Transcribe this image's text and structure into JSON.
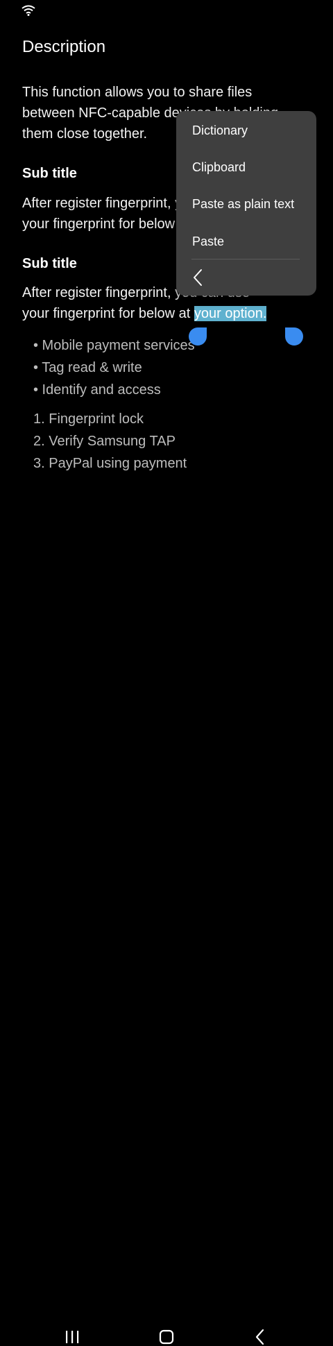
{
  "content": {
    "title": "Description",
    "paragraph1": {
      "line1": "This function allows you to share files",
      "line2": "between NFC-capable devices by holding",
      "line3": "them close together."
    },
    "subtitle1": "Sub title",
    "paragraph2": {
      "line1": "After register fingerprint, you can use",
      "line2": "your fingerprint for below at your option."
    },
    "subtitle2": "Sub title",
    "paragraph3": {
      "line1": "After register fingerprint, you can use",
      "line2_prefix": "your fingerprint for below at ",
      "line2_selected": "your option."
    },
    "bullets": [
      "• Mobile payment services",
      "• Tag read & write",
      "• Identify and access"
    ],
    "numbered": [
      "1. Fingerprint lock",
      "2. Verify Samsung TAP",
      "3. PayPal using payment"
    ]
  },
  "context_menu": {
    "items": [
      "Dictionary",
      "Clipboard",
      "Paste as plain text",
      "Paste"
    ],
    "back_icon": "chevron-left-icon"
  },
  "nav_bar": {
    "icons": [
      "recents-icon",
      "home-icon",
      "back-icon"
    ]
  },
  "colors": {
    "background": "#000000",
    "menu_background": "#3f3f3f",
    "selection": "#5fb1cf",
    "handle": "#3a8cf0",
    "list_text": "#bdbdbd"
  }
}
